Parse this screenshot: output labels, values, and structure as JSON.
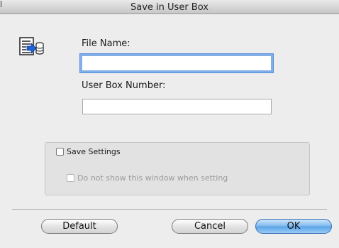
{
  "window": {
    "title": "Save in User Box"
  },
  "icons": {
    "document": "save-to-box-icon"
  },
  "fields": {
    "file_name_label": "File Name:",
    "file_name_value": "",
    "user_box_label": "User Box Number:",
    "user_box_value": ""
  },
  "options": {
    "save_settings_label": "Save Settings",
    "save_settings_checked": false,
    "dont_show_label": "Do not show this window when setting",
    "dont_show_checked": false,
    "dont_show_enabled": false
  },
  "buttons": {
    "default": "Default",
    "cancel": "Cancel",
    "ok": "OK"
  },
  "colors": {
    "focus_ring": "#7faee8",
    "default_button": "#5aa2e6"
  }
}
